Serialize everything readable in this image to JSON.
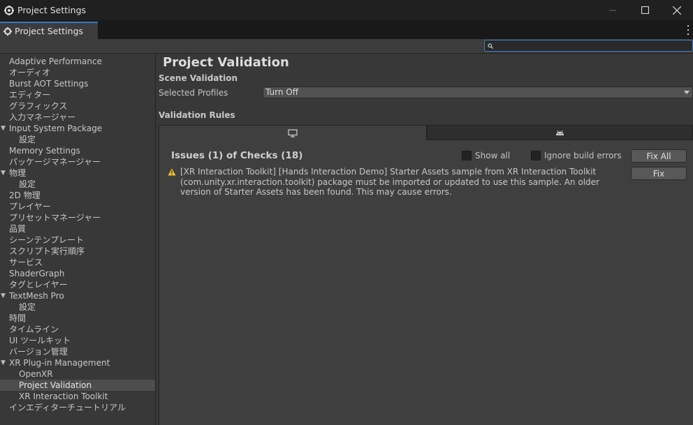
{
  "window": {
    "title": "Project Settings"
  },
  "tab": {
    "label": "Project Settings"
  },
  "search": {
    "placeholder": "",
    "value": ""
  },
  "sidebar": {
    "items": [
      {
        "label": "Adaptive Performance",
        "level": 0
      },
      {
        "label": "オーディオ",
        "level": 0
      },
      {
        "label": "Burst AOT Settings",
        "level": 0
      },
      {
        "label": "エディター",
        "level": 0
      },
      {
        "label": "グラフィックス",
        "level": 0
      },
      {
        "label": "入力マネージャー",
        "level": 0
      },
      {
        "label": "Input System Package",
        "level": 0,
        "expanded": true
      },
      {
        "label": "設定",
        "level": 1
      },
      {
        "label": "Memory Settings",
        "level": 0
      },
      {
        "label": "パッケージマネージャー",
        "level": 0
      },
      {
        "label": "物理",
        "level": 0,
        "expanded": true
      },
      {
        "label": "設定",
        "level": 1
      },
      {
        "label": "2D 物理",
        "level": 0
      },
      {
        "label": "プレイヤー",
        "level": 0
      },
      {
        "label": "プリセットマネージャー",
        "level": 0
      },
      {
        "label": "品質",
        "level": 0
      },
      {
        "label": "シーンテンプレート",
        "level": 0
      },
      {
        "label": "スクリプト実行順序",
        "level": 0
      },
      {
        "label": "サービス",
        "level": 0
      },
      {
        "label": "ShaderGraph",
        "level": 0
      },
      {
        "label": "タグとレイヤー",
        "level": 0
      },
      {
        "label": "TextMesh Pro",
        "level": 0,
        "expanded": true
      },
      {
        "label": "設定",
        "level": 1
      },
      {
        "label": "時間",
        "level": 0
      },
      {
        "label": "タイムライン",
        "level": 0
      },
      {
        "label": "UI ツールキット",
        "level": 0
      },
      {
        "label": "バージョン管理",
        "level": 0
      },
      {
        "label": "XR Plug-in Management",
        "level": 0,
        "expanded": true
      },
      {
        "label": "OpenXR",
        "level": 1
      },
      {
        "label": "Project Validation",
        "level": 1,
        "selected": true
      },
      {
        "label": "XR Interaction Toolkit",
        "level": 1
      },
      {
        "label": "インエディターチュートリアル",
        "level": 0
      }
    ]
  },
  "main": {
    "title": "Project Validation",
    "scene_validation": "Scene Validation",
    "selected_profiles_label": "Selected Profiles",
    "selected_profiles_value": "Turn Off",
    "validation_rules": "Validation Rules",
    "platform_tabs": [
      {
        "icon": "desktop-icon",
        "active": true
      },
      {
        "icon": "android-icon",
        "active": false
      }
    ],
    "issues_header": "Issues (1) of Checks (18)",
    "show_all_label": "Show all",
    "ignore_build_errors_label": "Ignore build errors",
    "fix_all_label": "Fix All",
    "issue": {
      "text": "[XR Interaction Toolkit] [Hands Interaction Demo] Starter Assets sample from XR Interaction Toolkit (com.unity.xr.interaction.toolkit) package must be imported or updated to use this sample. An older version of Starter Assets has been found. This may cause errors.",
      "fix_label": "Fix"
    }
  },
  "colors": {
    "accent": "#3a79bb",
    "warning": "#f4c430",
    "background": "#383838",
    "titlebar": "#202020"
  }
}
